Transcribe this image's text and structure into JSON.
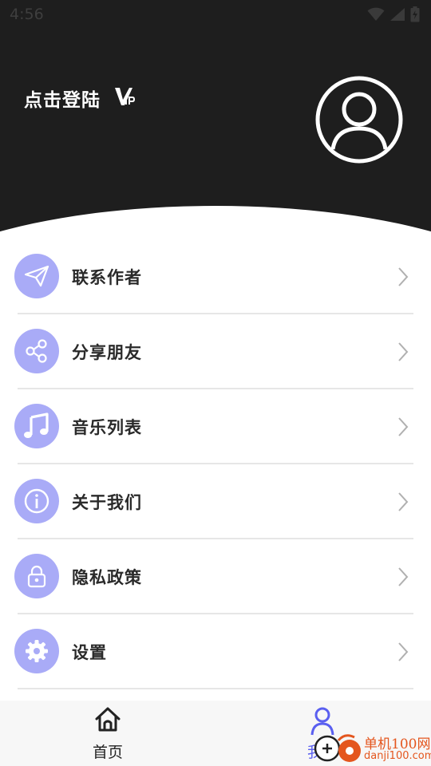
{
  "status_bar": {
    "time": "4:56"
  },
  "header": {
    "login_text": "点击登陆",
    "vip_badge": "VIP"
  },
  "menu": {
    "items": [
      {
        "label": "联系作者",
        "icon": "paper-plane-icon"
      },
      {
        "label": "分享朋友",
        "icon": "share-icon"
      },
      {
        "label": "音乐列表",
        "icon": "music-note-icon"
      },
      {
        "label": "关于我们",
        "icon": "info-icon"
      },
      {
        "label": "隐私政策",
        "icon": "lock-icon"
      },
      {
        "label": "设置",
        "icon": "gear-icon"
      }
    ]
  },
  "tabbar": {
    "tabs": [
      {
        "label": "首页",
        "icon": "home-icon"
      },
      {
        "label": "我的",
        "icon": "user-icon",
        "active": true
      }
    ]
  },
  "watermark": {
    "line1": "单机100网",
    "line2": "danji100.com"
  },
  "colors": {
    "header_bg": "#1e1e1e",
    "icon_bg": "#a9abf7",
    "accent": "#5a5ff0"
  }
}
